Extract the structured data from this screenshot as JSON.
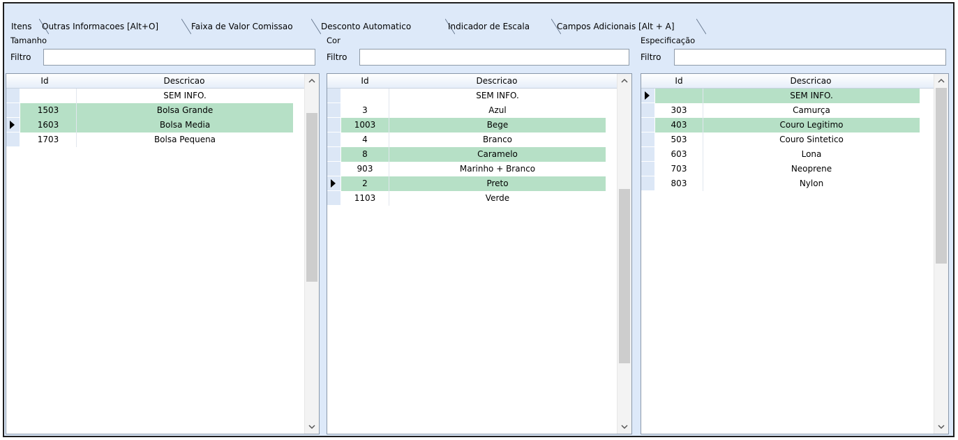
{
  "tabs": [
    {
      "label": "Itens",
      "active": true
    },
    {
      "label": "Outras Informacoes [Alt+O]"
    },
    {
      "label": "Faixa de Valor Comissao"
    },
    {
      "label": "Desconto Automatico"
    },
    {
      "label": "Indicador de Escala"
    },
    {
      "label": "Campos Adicionais [Alt + A]"
    }
  ],
  "panels": {
    "tamanho": {
      "title": "Tamanho",
      "filter_label": "Filtro",
      "filter_value": "",
      "columns": {
        "id": "Id",
        "desc": "Descricao"
      },
      "rows": [
        {
          "id": "",
          "desc": "SEM INFO."
        },
        {
          "id": "1503",
          "desc": "Bolsa Grande"
        },
        {
          "id": "1603",
          "desc": "Bolsa Media"
        },
        {
          "id": "1703",
          "desc": "Bolsa Pequena"
        }
      ]
    },
    "cor": {
      "title": "Cor",
      "filter_label": "Filtro",
      "filter_value": "",
      "columns": {
        "id": "Id",
        "desc": "Descricao"
      },
      "rows": [
        {
          "id": "",
          "desc": "SEM INFO."
        },
        {
          "id": "3",
          "desc": "Azul"
        },
        {
          "id": "1003",
          "desc": "Bege"
        },
        {
          "id": "4",
          "desc": "Branco"
        },
        {
          "id": "8",
          "desc": "Caramelo"
        },
        {
          "id": "903",
          "desc": "Marinho + Branco"
        },
        {
          "id": "2",
          "desc": "Preto"
        },
        {
          "id": "1103",
          "desc": "Verde"
        }
      ]
    },
    "especificacao": {
      "title": "Especificação",
      "filter_label": "Filtro",
      "filter_value": "",
      "columns": {
        "id": "Id",
        "desc": "Descricao"
      },
      "rows": [
        {
          "id": "",
          "desc": "SEM INFO."
        },
        {
          "id": "303",
          "desc": "Camurça"
        },
        {
          "id": "403",
          "desc": "Couro Legitimo"
        },
        {
          "id": "503",
          "desc": "Couro Sintetico"
        },
        {
          "id": "603",
          "desc": "Lona"
        },
        {
          "id": "703",
          "desc": "Neoprene"
        },
        {
          "id": "803",
          "desc": "Nylon"
        }
      ]
    }
  },
  "colors": {
    "selected_row": "#b6e0c6",
    "window_bg": "#dde9f9"
  },
  "icons": {
    "current_row": "row-pointer-icon",
    "scroll_up": "chevron-up-icon",
    "scroll_down": "chevron-down-icon"
  }
}
